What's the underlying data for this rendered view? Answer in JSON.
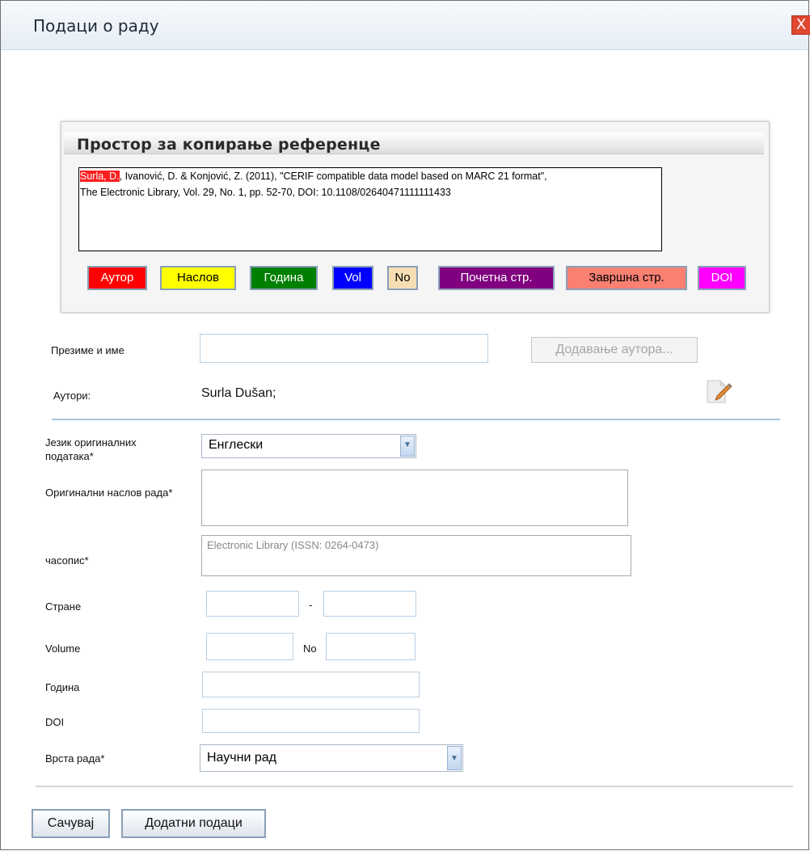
{
  "dialog": {
    "title": "Подаци о раду",
    "close_label": "X"
  },
  "reference": {
    "section_title": "Простор за копирање референце",
    "author_highlight": "Surla, D.",
    "text_line1_rest": ", Ivanović, D. & Konjović, Z. (2011), \"CERIF compatible data model based on MARC 21 format\",",
    "text_line2": "The Electronic Library, Vol. 29, No. 1, pp. 52-70, DOI: 10.1108/02640471111111433",
    "tags": [
      {
        "label": "Аутор",
        "bg": "#ff0000",
        "color": "#ffffff"
      },
      {
        "label": "Наслов",
        "bg": "#ffff00",
        "color": "#000000"
      },
      {
        "label": "Година",
        "bg": "#008000",
        "color": "#ffffff"
      },
      {
        "label": "Vol",
        "bg": "#0000ff",
        "color": "#ffffff"
      },
      {
        "label": "No",
        "bg": "#f5deb3",
        "color": "#000000"
      },
      {
        "label": "Почетна стр.",
        "bg": "#800080",
        "color": "#ffffff"
      },
      {
        "label": "Завршна стр.",
        "bg": "#fa8072",
        "color": "#000000"
      },
      {
        "label": "DOI",
        "bg": "#ff00ff",
        "color": "#ffffff"
      }
    ]
  },
  "author_section": {
    "surname_label": "Презиме и име",
    "surname_value": "",
    "add_author_button": "Додавање аутора...",
    "authors_label": "Аутори:",
    "authors_value": "Surla Dušan;",
    "edit_icon": "edit-pencil-icon"
  },
  "form": {
    "language_label": "Језик оригиналних података*",
    "language_value": "Енглески",
    "title_label": "Оригинални наслов рада*",
    "title_value": "",
    "journal_label": "часопис*",
    "journal_value": "Electronic Library (ISSN: 0264-0473)",
    "pages_label": "Стране",
    "pages_separator": "-",
    "page_start": "",
    "page_end": "",
    "volume_label": "Volume",
    "no_label": "No",
    "volume_value": "",
    "no_value": "",
    "year_label": "Година",
    "year_value": "",
    "doi_label": "DOI",
    "doi_value": "",
    "type_label": "Врста рада*",
    "type_value": "Научни рад"
  },
  "footer": {
    "save_button": "Сачувај",
    "extra_button": "Додатни подаци"
  },
  "colors": {
    "divider": "#a9c3de",
    "title_bar": "#e6edf5"
  }
}
